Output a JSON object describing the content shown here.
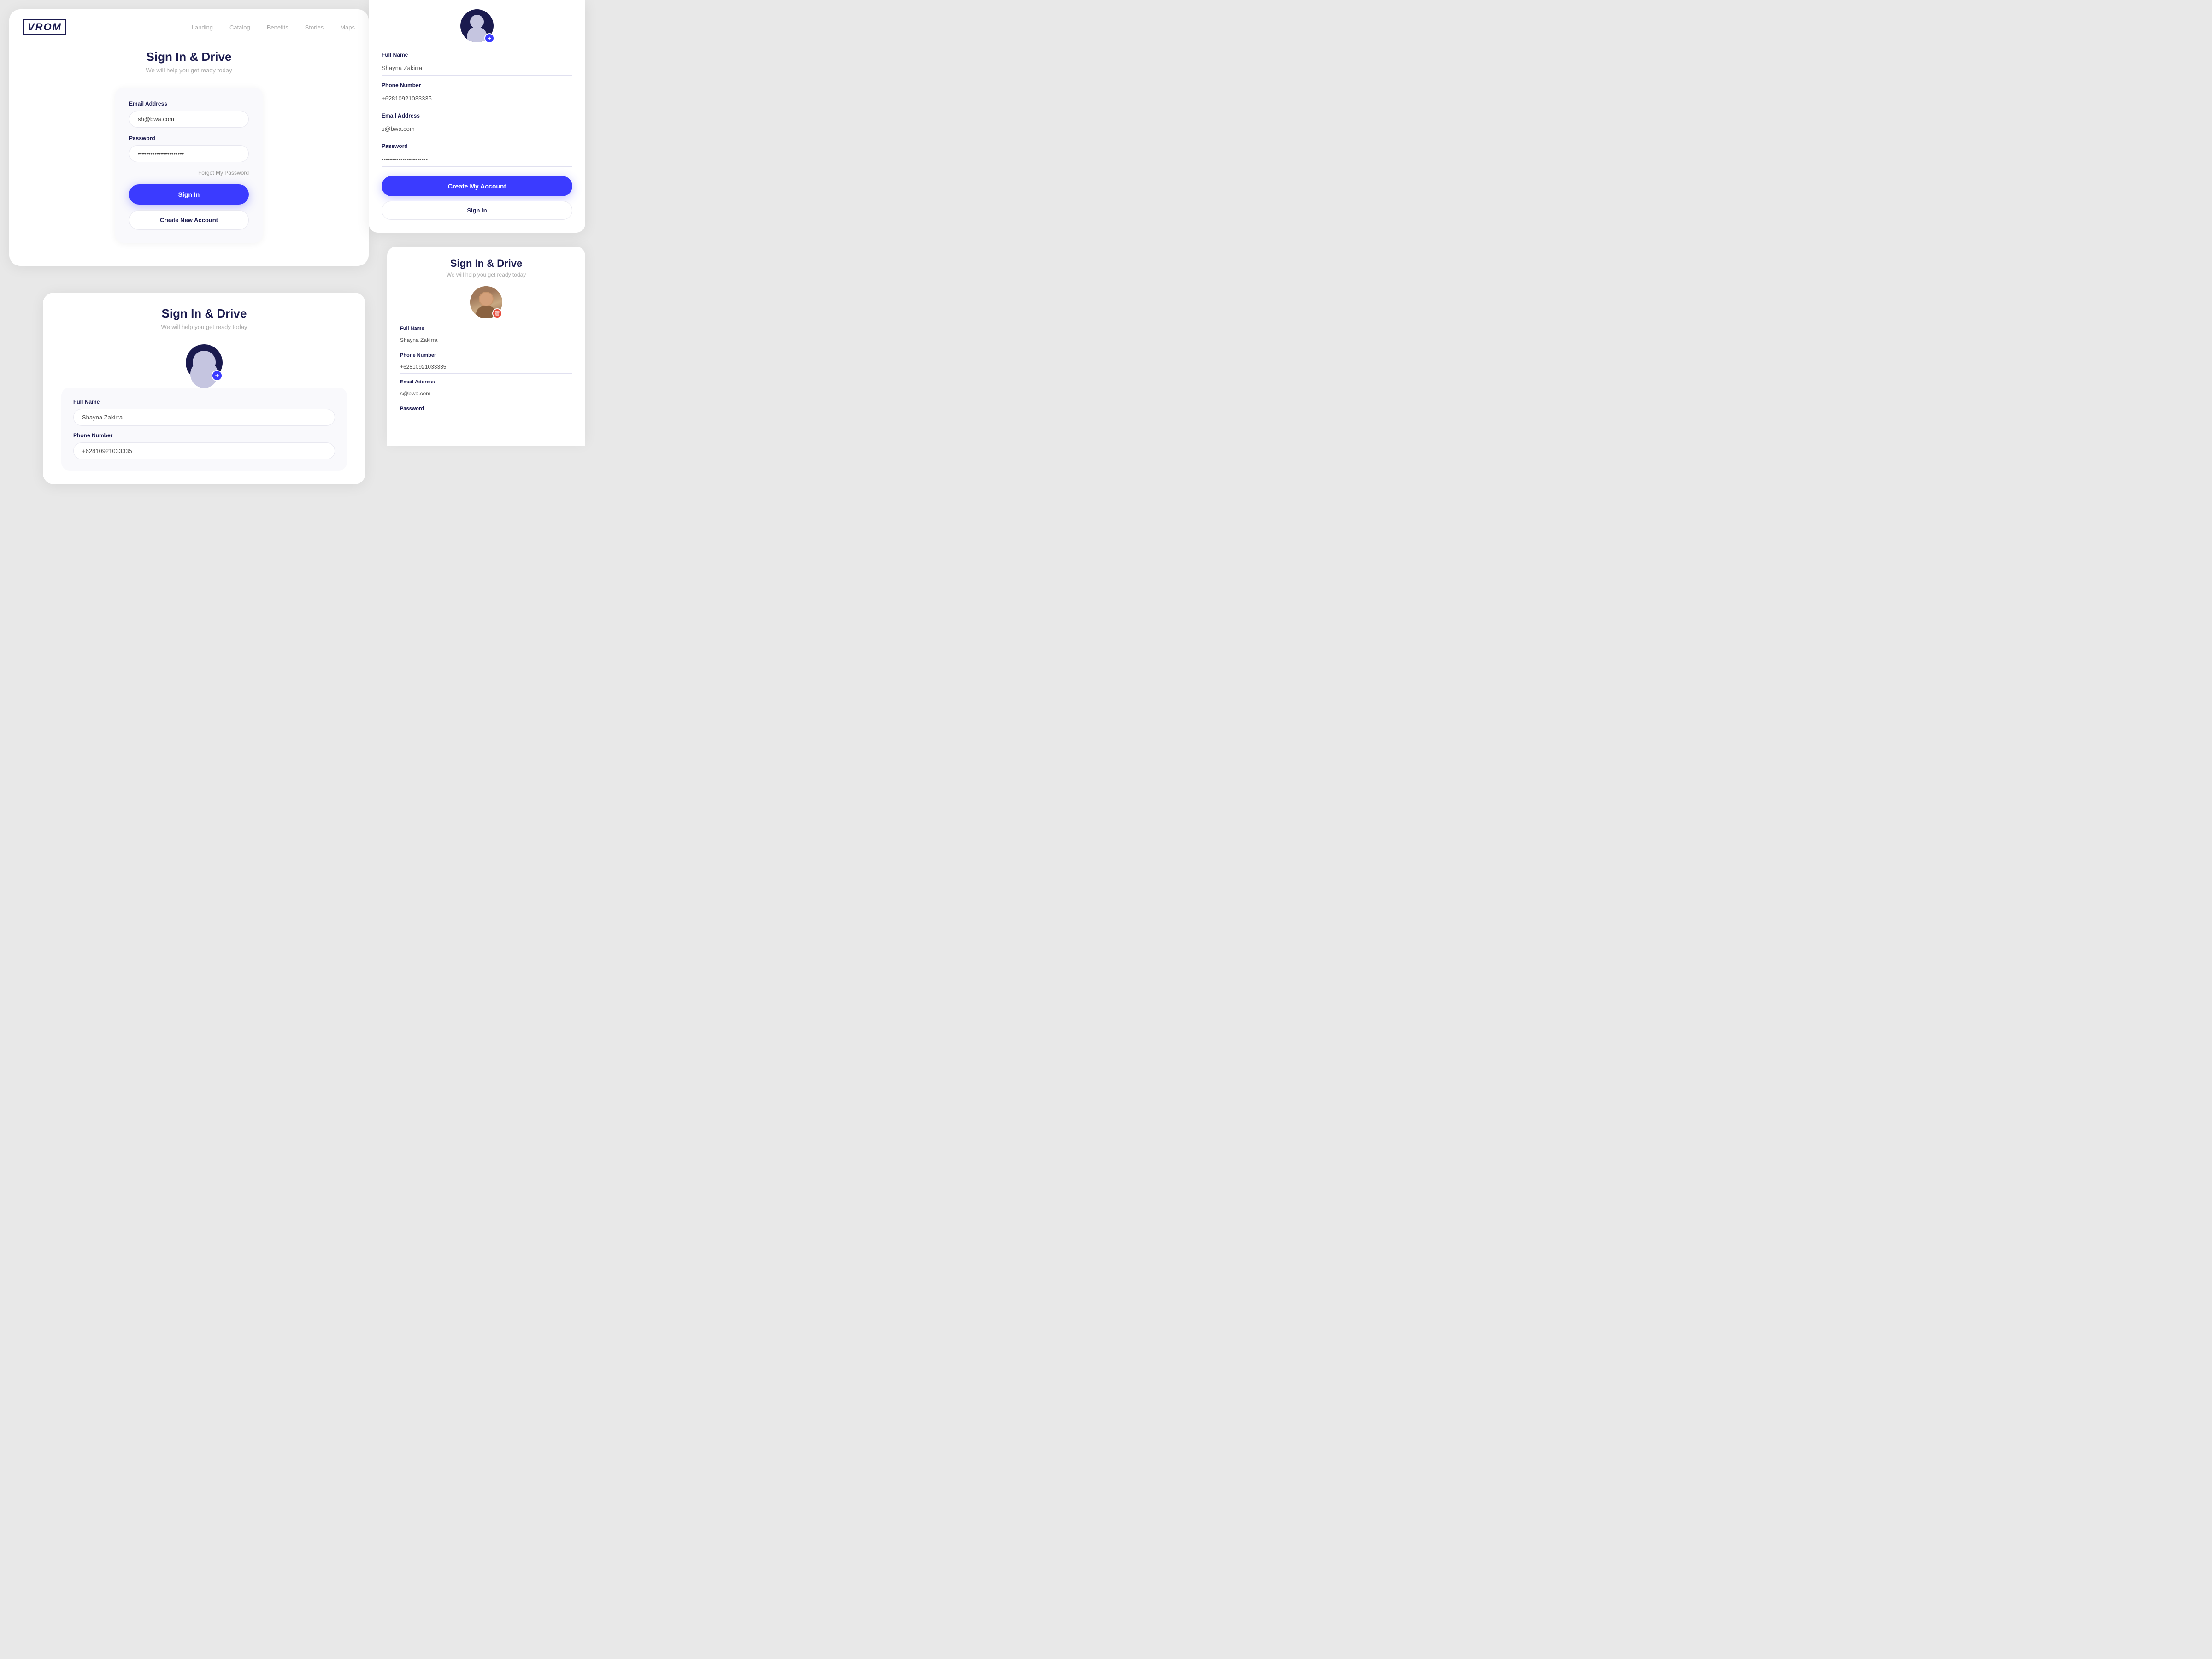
{
  "app": {
    "name": "VROM"
  },
  "nav": {
    "links": [
      "Landing",
      "Catalog",
      "Benefits",
      "Stories",
      "Maps"
    ]
  },
  "signin_card": {
    "title": "Sign In & Drive",
    "subtitle": "We will help you get ready today",
    "email_label": "Email Address",
    "email_value": "sh@bwa.com",
    "password_label": "Password",
    "password_value": "••••••••••••••••••••••",
    "forgot_label": "Forgot My Password",
    "signin_btn": "Sign In",
    "create_btn": "Create New Account"
  },
  "create_top": {
    "full_name_label": "Full Name",
    "full_name_value": "Shayna Zakirra",
    "phone_label": "Phone Number",
    "phone_value": "+62810921033335",
    "email_label": "Email Address",
    "email_value": "s@bwa.com",
    "password_label": "Password",
    "password_value": "••••••••••••••••••••••",
    "create_btn": "Create My Account",
    "signin_btn": "Sign In",
    "avatar_plus": "+"
  },
  "create_bottom_left": {
    "title": "Sign In & Drive",
    "subtitle": "We will help you get ready today",
    "full_name_label": "Full Name",
    "full_name_value": "Shayna Zakirra",
    "phone_label": "Phone Number",
    "phone_value": "+62810921033335",
    "avatar_plus": "+"
  },
  "bottom_right": {
    "title": "Sign In & Drive",
    "subtitle": "We will help you get ready today",
    "full_name_label": "Full Name",
    "full_name_value": "Shayna Zakirra",
    "phone_label": "Phone Number",
    "phone_value": "+62810921033335",
    "email_label": "Email Address",
    "email_value": "s@bwa.com",
    "password_label": "Password",
    "delete_icon": "🗑"
  }
}
